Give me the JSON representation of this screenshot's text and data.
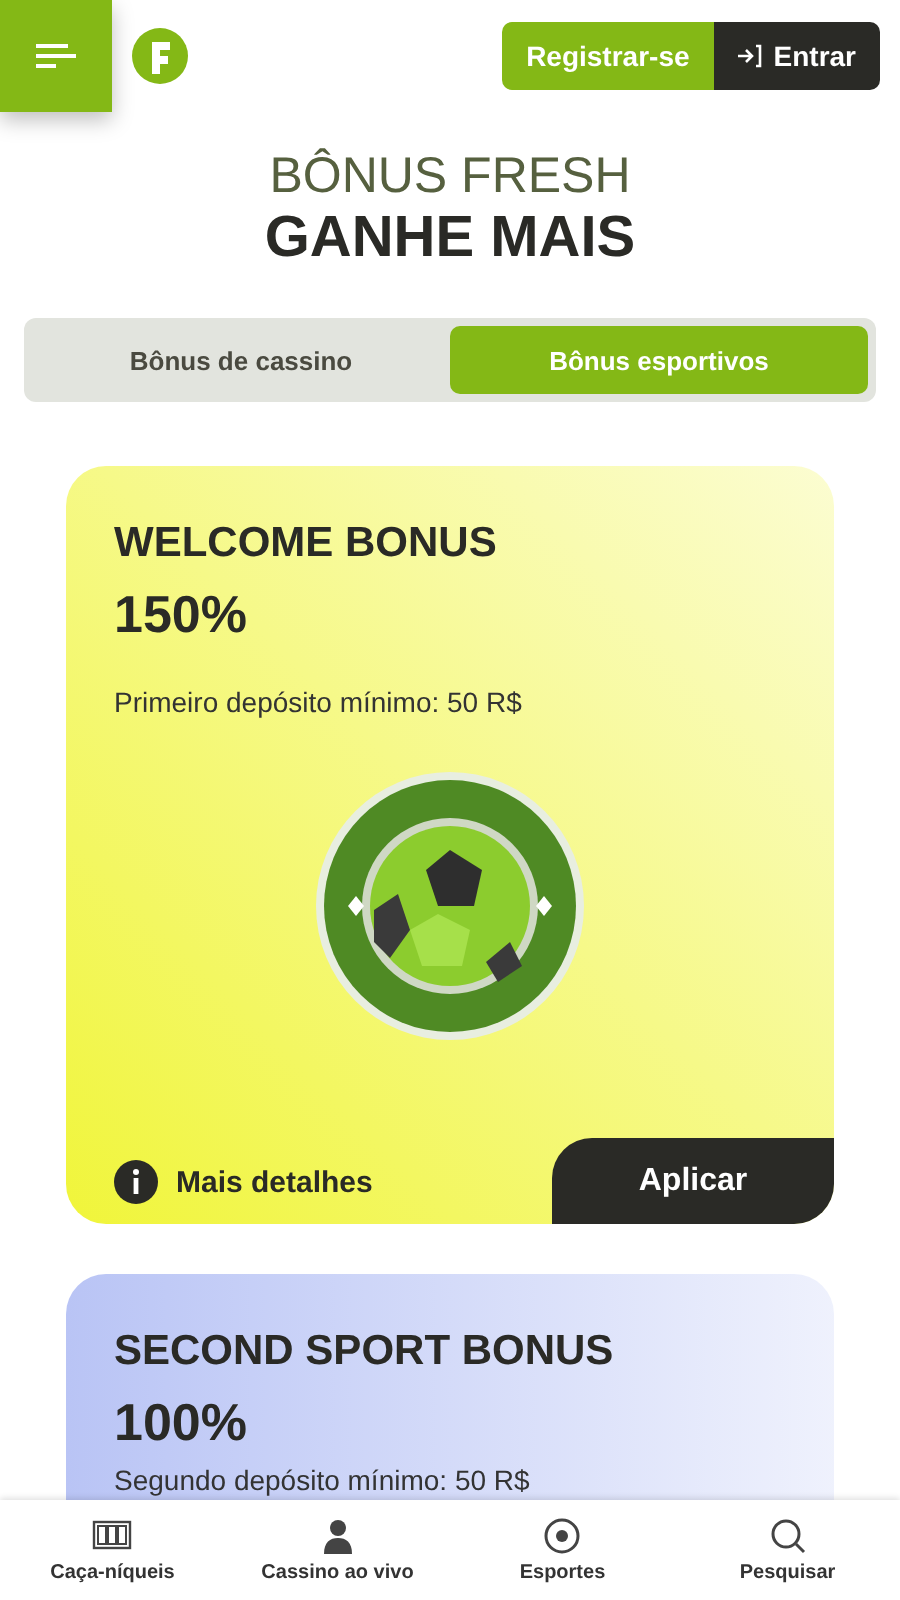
{
  "header": {
    "register": "Registrar-se",
    "login": "Entrar"
  },
  "heading": {
    "top": "BÔNUS FRESH",
    "bottom": "GANHE MAIS"
  },
  "tabs": [
    {
      "label": "Bônus de cassino",
      "selected": false
    },
    {
      "label": "Bônus esportivos",
      "selected": true
    }
  ],
  "bonuses": [
    {
      "title": "WELCOME BONUS",
      "amount": "150%",
      "condition": "Primeiro depósito mínimo: 50 R$",
      "color": "#f0f53a",
      "details": "Mais detalhes",
      "apply": "Aplicar"
    },
    {
      "title": "SECOND SPORT BONUS",
      "amount": "100%",
      "condition": "Segundo depósito mínimo: 50 R$",
      "color": "#b9c4f5"
    }
  ],
  "bottom_nav": [
    {
      "label": "Caça-níqueis"
    },
    {
      "label": "Cassino ao vivo"
    },
    {
      "label": "Esportes"
    },
    {
      "label": "Pesquisar"
    }
  ]
}
